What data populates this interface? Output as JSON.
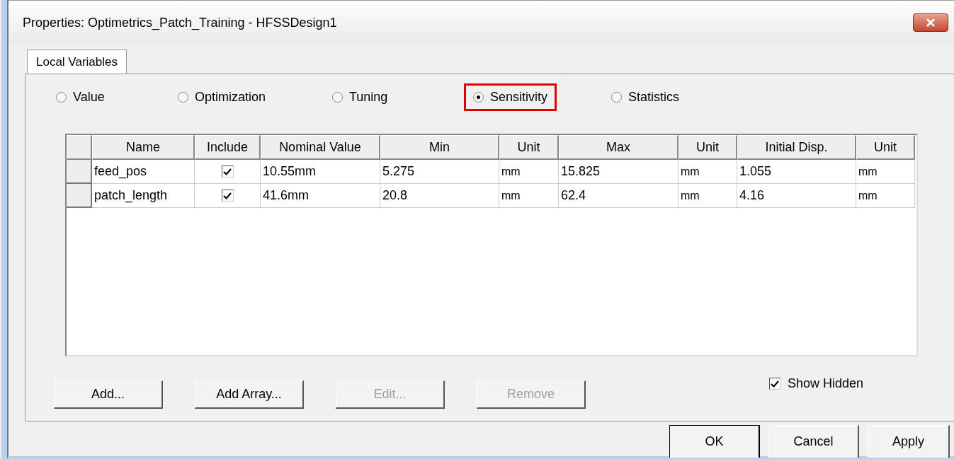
{
  "window": {
    "title": "Properties: Optimetrics_Patch_Training - HFSSDesign1"
  },
  "tabs": [
    {
      "label": "Local Variables",
      "selected": true
    }
  ],
  "modes": [
    {
      "label": "Value",
      "selected": false,
      "highlighted": false
    },
    {
      "label": "Optimization",
      "selected": false,
      "highlighted": false
    },
    {
      "label": "Tuning",
      "selected": false,
      "highlighted": false
    },
    {
      "label": "Sensitivity",
      "selected": true,
      "highlighted": true
    },
    {
      "label": "Statistics",
      "selected": false,
      "highlighted": false
    }
  ],
  "table": {
    "columns": [
      "Name",
      "Include",
      "Nominal Value",
      "Min",
      "Unit",
      "Max",
      "Unit",
      "Initial Disp.",
      "Unit"
    ],
    "rows": [
      {
        "name": "feed_pos",
        "include": true,
        "nominal_value": "10.55mm",
        "min": "5.275",
        "min_unit": "mm",
        "max": "15.825",
        "max_unit": "mm",
        "initial_disp": "1.055",
        "initial_disp_unit": "mm"
      },
      {
        "name": "patch_length",
        "include": true,
        "nominal_value": "41.6mm",
        "min": "20.8",
        "min_unit": "mm",
        "max": "62.4",
        "max_unit": "mm",
        "initial_disp": "4.16",
        "initial_disp_unit": "mm"
      }
    ]
  },
  "buttons": [
    {
      "label": "Add...",
      "disabled": false
    },
    {
      "label": "Add Array...",
      "disabled": false
    },
    {
      "label": "Edit...",
      "disabled": true
    },
    {
      "label": "Remove",
      "disabled": true
    }
  ],
  "show_hidden": {
    "label": "Show Hidden",
    "checked": true
  },
  "dialog_buttons": [
    {
      "label": "OK",
      "default": true
    },
    {
      "label": "Cancel",
      "default": false
    },
    {
      "label": "Apply",
      "default": false
    }
  ]
}
